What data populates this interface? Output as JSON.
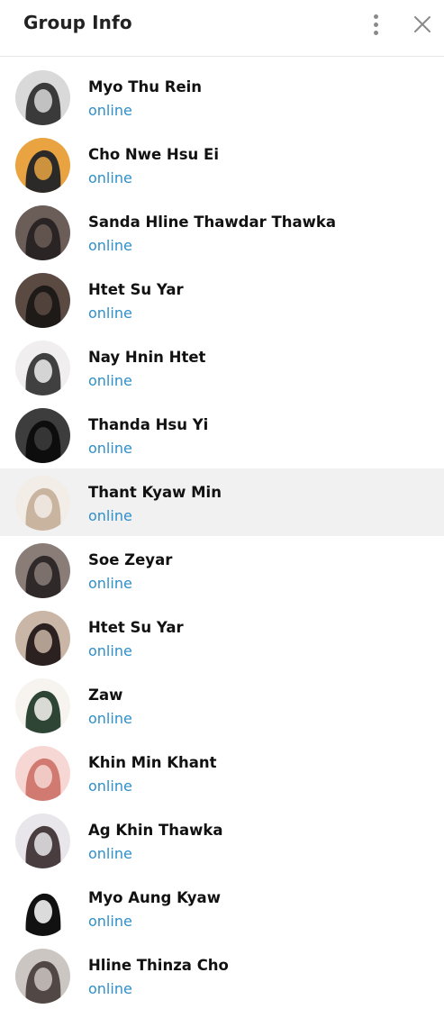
{
  "header": {
    "title": "Group Info",
    "more_icon": "more-vertical-icon",
    "close_icon": "close-icon"
  },
  "members": [
    {
      "name": "Myo Thu Rein",
      "status": "online",
      "avatar_colors": [
        "#d9d9d9",
        "#3a3a3a"
      ]
    },
    {
      "name": "Cho Nwe Hsu Ei",
      "status": "online",
      "avatar_colors": [
        "#e9a441",
        "#2c2a28"
      ]
    },
    {
      "name": "Sanda Hline Thawdar Thawka",
      "status": "online",
      "avatar_colors": [
        "#6b5d57",
        "#2b2424"
      ]
    },
    {
      "name": "Htet Su Yar",
      "status": "online",
      "avatar_colors": [
        "#5a4a42",
        "#1e1a18"
      ]
    },
    {
      "name": "Nay Hnin Htet",
      "status": "online",
      "avatar_colors": [
        "#f0eeee",
        "#404040"
      ]
    },
    {
      "name": "Thanda Hsu Yi",
      "status": "online",
      "avatar_colors": [
        "#3d3d3d",
        "#0d0d0d"
      ]
    },
    {
      "name": "Thant Kyaw Min",
      "status": "online",
      "avatar_colors": [
        "#f3ede8",
        "#c9b4a0"
      ]
    },
    {
      "name": "Soe Zeyar",
      "status": "online",
      "avatar_colors": [
        "#8a7d78",
        "#2f2a29"
      ]
    },
    {
      "name": "Htet Su Yar",
      "status": "online",
      "avatar_colors": [
        "#c9b6a6",
        "#2b2120"
      ]
    },
    {
      "name": "Zaw",
      "status": "online",
      "avatar_colors": [
        "#f7f4ef",
        "#2e4536"
      ]
    },
    {
      "name": "Khin Min Khant",
      "status": "online",
      "avatar_colors": [
        "#f6d7d3",
        "#d17a72"
      ]
    },
    {
      "name": "Ag Khin Thawka",
      "status": "online",
      "avatar_colors": [
        "#e8e6ea",
        "#4a3d40"
      ]
    },
    {
      "name": "Myo Aung Kyaw",
      "status": "online",
      "avatar_colors": [
        "#ffffff",
        "#111111"
      ]
    },
    {
      "name": "Hline Thinza Cho",
      "status": "online",
      "avatar_colors": [
        "#cbc6c2",
        "#514744"
      ]
    }
  ],
  "active_index": 6
}
